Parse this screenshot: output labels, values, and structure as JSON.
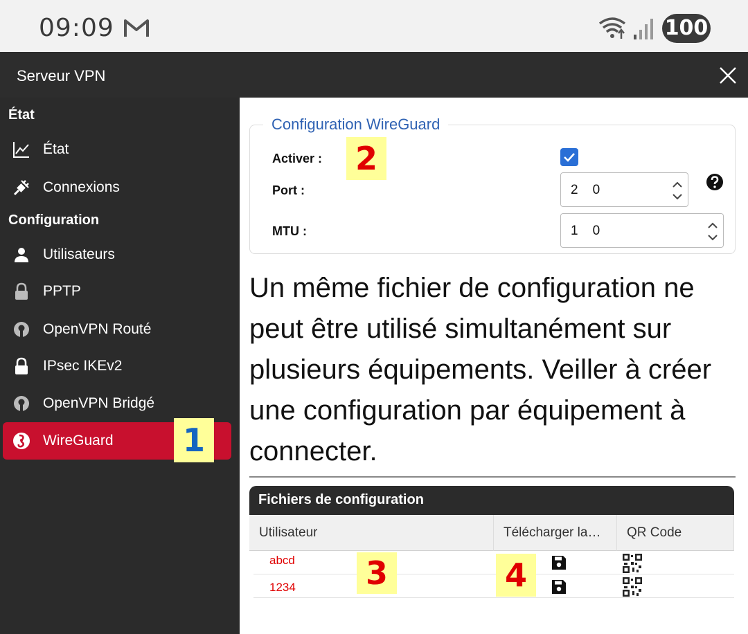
{
  "status_bar": {
    "time": "09:09",
    "battery": "100"
  },
  "header": {
    "title": "Serveur VPN"
  },
  "sidebar": {
    "section_state": "État",
    "section_config": "Configuration",
    "items": [
      {
        "label": "État",
        "icon": "chart-line-icon"
      },
      {
        "label": "Connexions",
        "icon": "plug-icon"
      },
      {
        "label": "Utilisateurs",
        "icon": "user-icon"
      },
      {
        "label": "PPTP",
        "icon": "lock-icon"
      },
      {
        "label": "OpenVPN Routé",
        "icon": "openvpn-icon"
      },
      {
        "label": "IPsec IKEv2",
        "icon": "lock-icon"
      },
      {
        "label": "OpenVPN Bridgé",
        "icon": "openvpn-icon"
      },
      {
        "label": "WireGuard",
        "icon": "wireguard-icon"
      }
    ],
    "active_index": 7
  },
  "wireguard": {
    "legend": "Configuration WireGuard",
    "activer_label": "Activer :",
    "activer_checked": true,
    "port_label": "Port :",
    "port_value": "2    0",
    "mtu_label": "MTU :",
    "mtu_value": "1    0"
  },
  "note": "Un même fichier de configuration ne peut être utilisé simultanément sur plusieurs équipements. Veiller à créer une configuration par équipement à connecter.",
  "files": {
    "title": "Fichiers de configuration",
    "columns": [
      "Utilisateur",
      "Télécharger la…",
      "QR Code"
    ],
    "rows": [
      {
        "user": "abcd"
      },
      {
        "user": "1234"
      }
    ]
  },
  "markers": [
    "1",
    "2",
    "3",
    "4"
  ],
  "colors": {
    "accent_red": "#c8102e",
    "legend_blue": "#2f62b3",
    "checkbox_blue": "#2a6fd6",
    "user_red": "#e00000"
  }
}
